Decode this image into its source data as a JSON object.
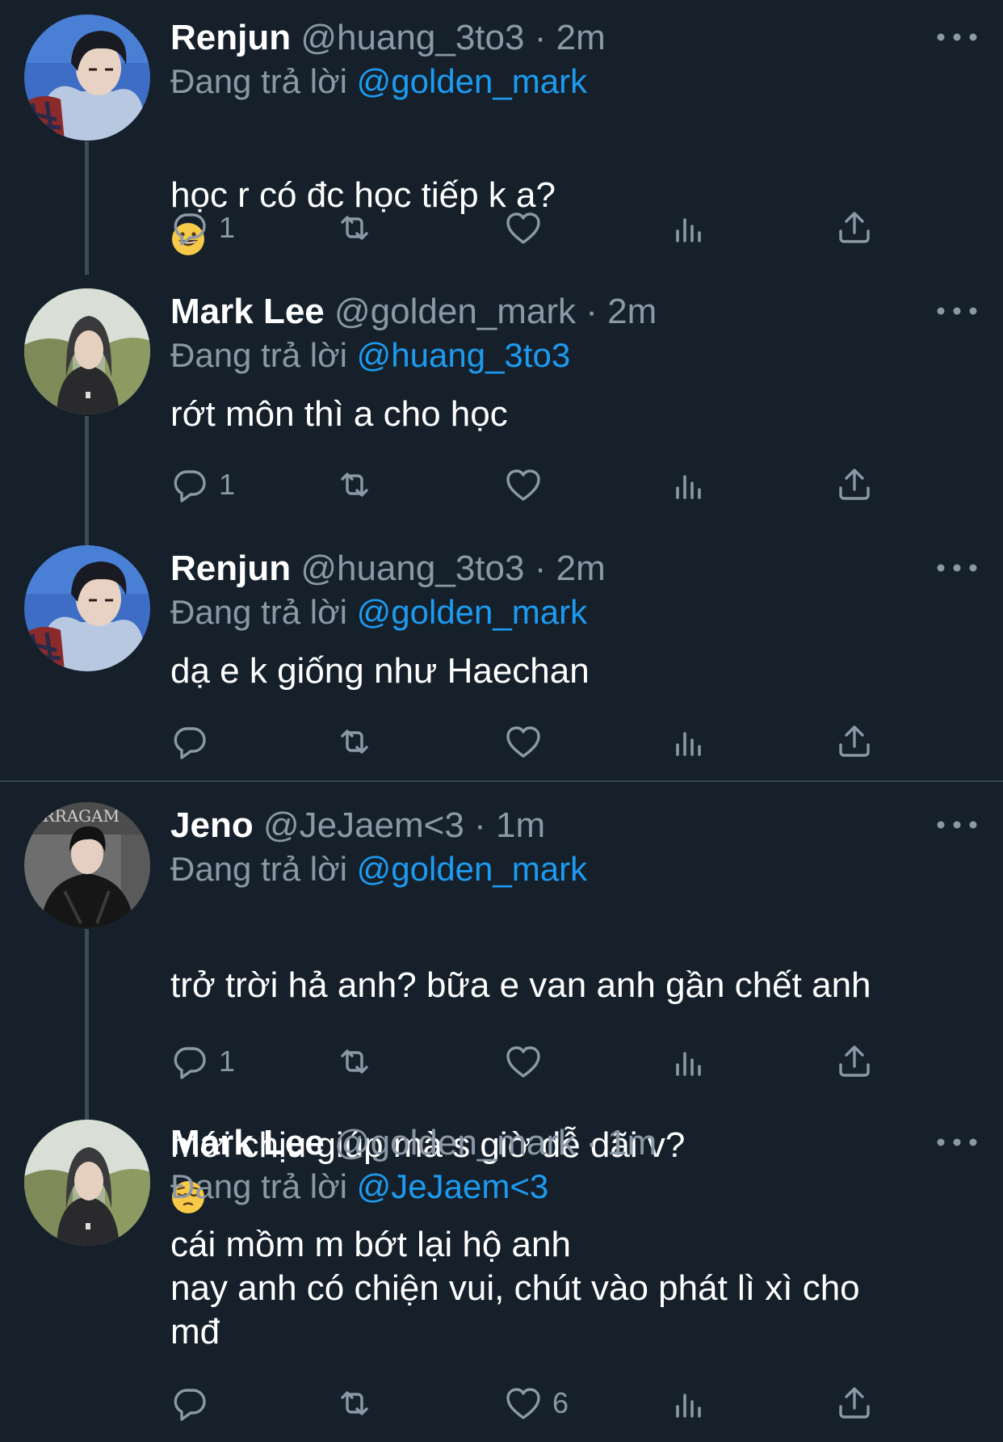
{
  "tweets": [
    {
      "name": "Renjun",
      "handle": "@huang_3to3",
      "dot": "·",
      "time": "2m",
      "reply_prefix": "Đang trả lời",
      "reply_to": "@golden_mark",
      "text": "học r có đc học tiếp k a?",
      "emoji": "grinning-face",
      "reply_count": "1",
      "like_count": "",
      "avatar": "renjun"
    },
    {
      "name": "Mark Lee",
      "handle": "@golden_mark",
      "dot": "·",
      "time": "2m",
      "reply_prefix": "Đang trả lời",
      "reply_to": "@huang_3to3",
      "text": "rớt môn thì a cho học",
      "reply_count": "1",
      "like_count": "",
      "avatar": "mark"
    },
    {
      "name": "Renjun",
      "handle": "@huang_3to3",
      "dot": "·",
      "time": "2m",
      "reply_prefix": "Đang trả lời",
      "reply_to": "@golden_mark",
      "text": "dạ e k giống như Haechan",
      "reply_count": "",
      "like_count": "",
      "avatar": "renjun"
    },
    {
      "name": "Jeno",
      "handle": "@JeJaem<3",
      "dot": "·",
      "time": "1m",
      "reply_prefix": "Đang trả lời",
      "reply_to": "@golden_mark",
      "text_line1": "trở trời hả anh? bữa e van anh gần chết anh",
      "text_line2": "mới chịu giúp mà s giờ dễ dãi v?",
      "emoji": "pensive-face",
      "reply_count": "1",
      "like_count": "",
      "avatar": "jeno"
    },
    {
      "name": "Mark Lee",
      "handle": "@golden_mark",
      "dot": "·",
      "time": "1m",
      "reply_prefix": "Đang trả lời",
      "reply_to": "@JeJaem<3",
      "text": "cái mồm m bớt lại hộ anh\nnay anh có chiện vui, chút vào phát lì xì cho\nmđ",
      "reply_count": "",
      "like_count": "6",
      "avatar": "mark"
    }
  ],
  "icons": {
    "reply": "reply-icon",
    "retweet": "retweet-icon",
    "like": "heart-icon",
    "views": "views-icon",
    "share": "share-icon",
    "more": "more-dots-icon"
  },
  "colors": {
    "background": "#15202b",
    "secondary_text": "#8b98a5",
    "link": "#1d9bf0",
    "thread_line": "#3d4a57",
    "divider": "#38444d"
  }
}
